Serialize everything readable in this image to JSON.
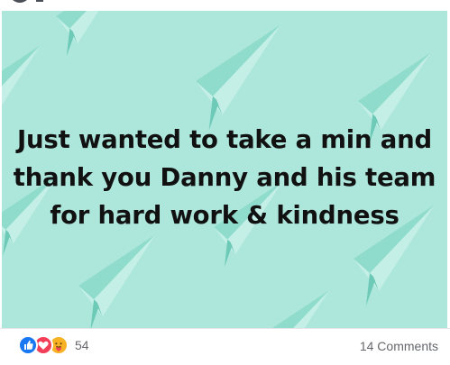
{
  "post": {
    "text_lines": [
      "Just wanted to take a min and",
      "thank you Danny and his team",
      "for hard work & kindness"
    ],
    "background_color": "#ade7dc",
    "plane_color": "#78cfbf",
    "text_color": "#111111"
  },
  "footer": {
    "reaction_icons": [
      "like-icon",
      "love-icon",
      "care-icon"
    ],
    "reaction_count": "54",
    "comments_label": "14 Comments"
  },
  "colors": {
    "like": "#1877f2",
    "love": "#f33e58",
    "care": "#f7b125",
    "meta_text": "#65676b"
  }
}
